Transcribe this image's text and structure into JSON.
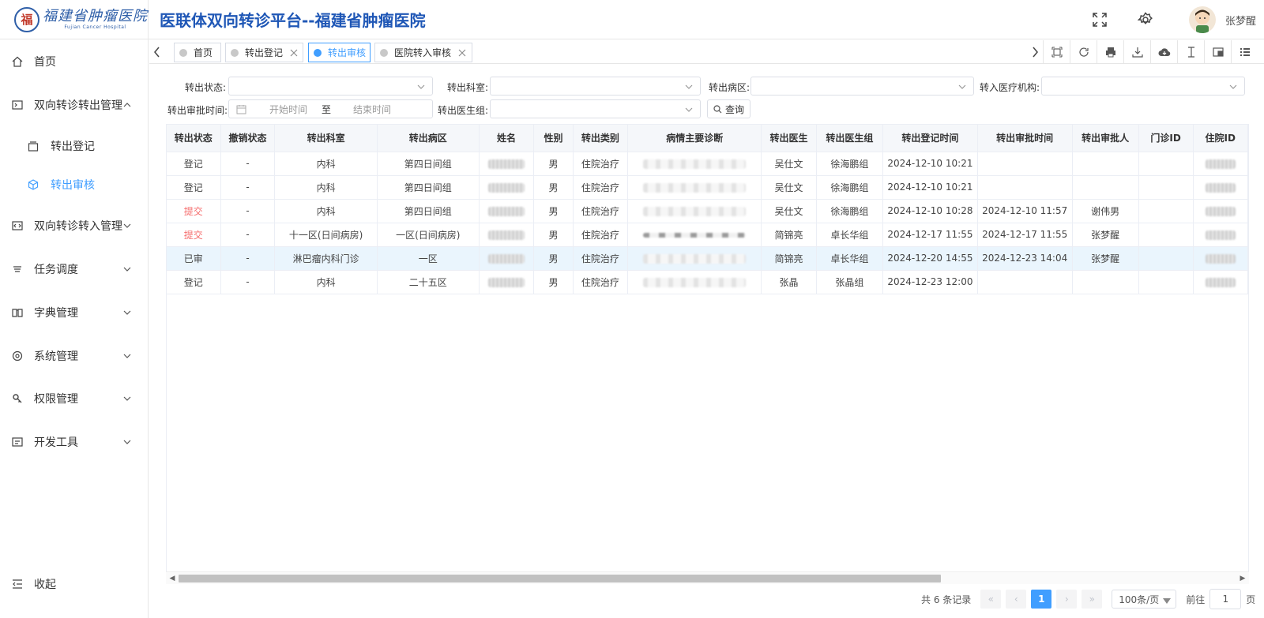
{
  "header": {
    "logo_seal": "福",
    "logo_text": "福建省肿瘤医院",
    "logo_en": "Fujian Cancer Hospital",
    "title": "医联体双向转诊平台--福建省肿瘤医院",
    "username": "张梦醒"
  },
  "sidebar": {
    "items": [
      {
        "label": "首页",
        "icon": "home-icon"
      },
      {
        "label": "双向转诊转出管理",
        "icon": "terminal-icon"
      },
      {
        "label": "转出登记",
        "icon": "register-icon"
      },
      {
        "label": "转出审核",
        "icon": "cube-icon"
      },
      {
        "label": "双向转诊转入管理",
        "icon": "code-icon"
      },
      {
        "label": "任务调度",
        "icon": "schedule-icon"
      },
      {
        "label": "字典管理",
        "icon": "book-icon"
      },
      {
        "label": "系统管理",
        "icon": "gear-icon"
      },
      {
        "label": "权限管理",
        "icon": "key-icon"
      },
      {
        "label": "开发工具",
        "icon": "dev-icon"
      }
    ],
    "collapse_label": "收起"
  },
  "tabs": [
    {
      "label": "首页"
    },
    {
      "label": "转出登记"
    },
    {
      "label": "转出审核"
    },
    {
      "label": "医院转入审核"
    }
  ],
  "filters": {
    "status_label": "转出状态:",
    "dept_label": "转出科室:",
    "ward_label": "转出病区:",
    "institution_label": "转入医疗机构:",
    "approve_time_label": "转出审批时间:",
    "start_placeholder": "开始时间",
    "range_sep": "至",
    "end_placeholder": "结束时间",
    "doctor_group_label": "转出医生组:",
    "query_button": "查询"
  },
  "table": {
    "columns": [
      "转出状态",
      "撤销状态",
      "转出科室",
      "转出病区",
      "姓名",
      "性别",
      "转出类别",
      "病情主要诊断",
      "转出医生",
      "转出医生组",
      "转出登记时间",
      "转出审批时间",
      "转出审批人",
      "门诊ID",
      "住院ID"
    ],
    "rows": [
      {
        "status": "登记",
        "cancel": "-",
        "dept": "内科",
        "ward": "第四日间组",
        "gender": "男",
        "category": "住院治疗",
        "doctor": "吴仕文",
        "group": "徐海鹏组",
        "reg_time": "2024-12-10 10:21",
        "approve_time": "",
        "approver": "",
        "red": false,
        "highlight": false
      },
      {
        "status": "登记",
        "cancel": "-",
        "dept": "内科",
        "ward": "第四日间组",
        "gender": "男",
        "category": "住院治疗",
        "doctor": "吴仕文",
        "group": "徐海鹏组",
        "reg_time": "2024-12-10 10:21",
        "approve_time": "",
        "approver": "",
        "red": false,
        "highlight": false
      },
      {
        "status": "提交",
        "cancel": "-",
        "dept": "内科",
        "ward": "第四日间组",
        "gender": "男",
        "category": "住院治疗",
        "doctor": "吴仕文",
        "group": "徐海鹏组",
        "reg_time": "2024-12-10 10:28",
        "approve_time": "2024-12-10 11:57",
        "approver": "谢伟男",
        "red": true,
        "highlight": false
      },
      {
        "status": "提交",
        "cancel": "-",
        "dept": "十一区(日间病房)",
        "ward": "一区(日间病房)",
        "gender": "男",
        "category": "住院治疗",
        "doctor": "简锦亮",
        "group": "卓长华组",
        "reg_time": "2024-12-17 11:55",
        "approve_time": "2024-12-17 11:55",
        "approver": "张梦醒",
        "red": true,
        "highlight": false
      },
      {
        "status": "已审",
        "cancel": "-",
        "dept": "淋巴瘤内科门诊",
        "ward": "一区",
        "gender": "男",
        "category": "住院治疗",
        "doctor": "简锦亮",
        "group": "卓长华组",
        "reg_time": "2024-12-20 14:55",
        "approve_time": "2024-12-23 14:04",
        "approver": "张梦醒",
        "red": false,
        "highlight": true
      },
      {
        "status": "登记",
        "cancel": "-",
        "dept": "内科",
        "ward": "二十五区",
        "gender": "男",
        "category": "住院治疗",
        "doctor": "张晶",
        "group": "张晶组",
        "reg_time": "2024-12-23 12:00",
        "approve_time": "",
        "approver": "",
        "red": false,
        "highlight": false
      }
    ]
  },
  "pagination": {
    "total_text": "共 6 条记录",
    "current_page": "1",
    "page_size": "100条/页",
    "goto_label": "前往",
    "goto_value": "1",
    "page_suffix": "页"
  },
  "colors": {
    "accent": "#409eff",
    "brand": "#1f57b6",
    "danger": "#f56c6c"
  }
}
